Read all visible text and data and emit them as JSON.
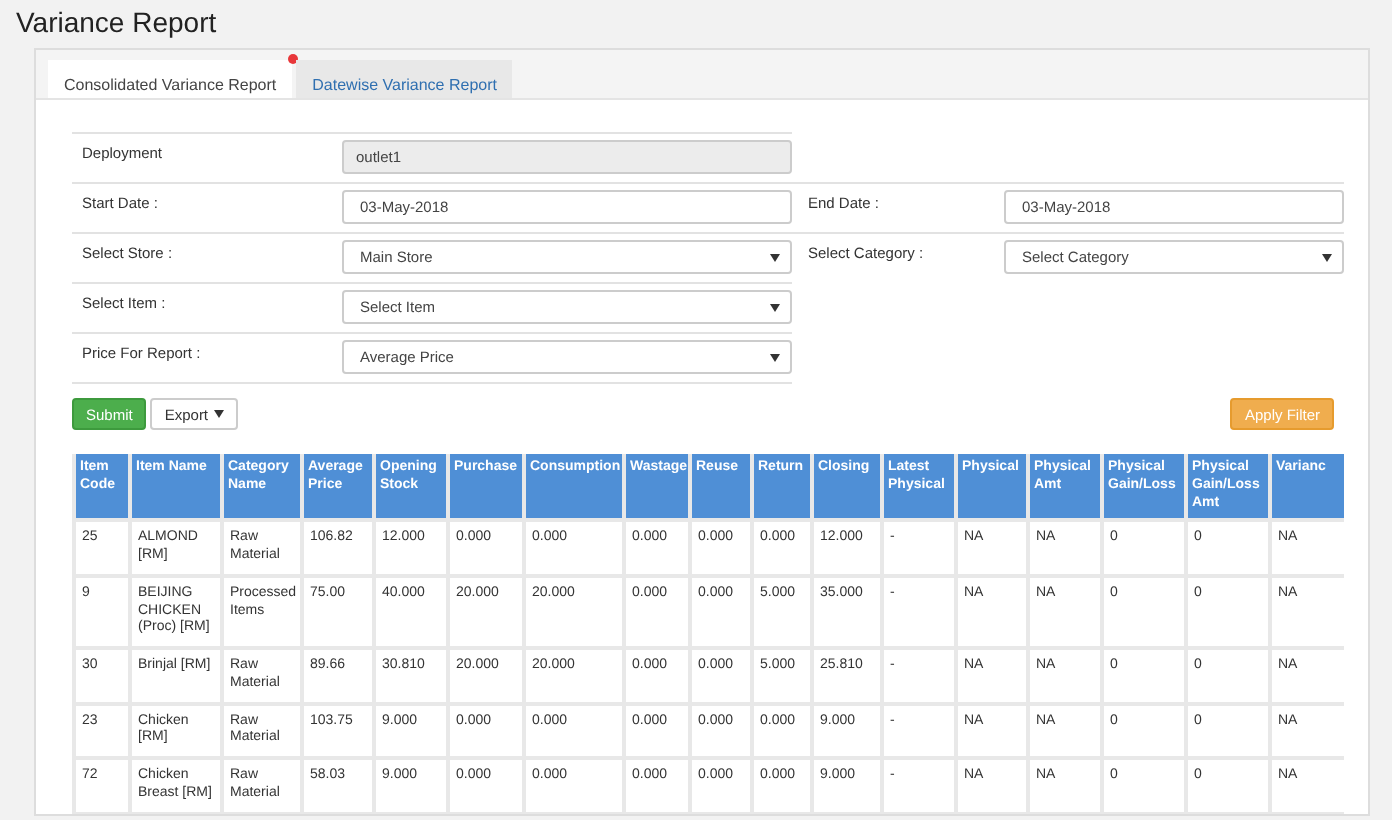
{
  "title": "Variance Report",
  "tabs": [
    {
      "label": "Consolidated Variance Report",
      "selected": true,
      "alert": true
    },
    {
      "label": "Datewise Variance Report",
      "selected": false,
      "alert": false
    }
  ],
  "form": {
    "rows": [
      [
        {
          "label": "Deployment",
          "kind": "readonly",
          "value": "outlet1"
        }
      ],
      [
        {
          "label": "Start Date :",
          "kind": "text",
          "value": "03-May-2018"
        },
        {
          "label": "End Date :",
          "kind": "text",
          "value": "03-May-2018"
        }
      ],
      [
        {
          "label": "Select Store :",
          "kind": "select",
          "value": "Main Store"
        },
        {
          "label": "Select Category :",
          "kind": "select",
          "value": "Select Category"
        }
      ],
      [
        {
          "label": "Select Item :",
          "kind": "select",
          "value": "Select Item"
        }
      ],
      [
        {
          "label": "Price For Report :",
          "kind": "select",
          "value": "Average Price"
        }
      ]
    ]
  },
  "buttons": [
    {
      "label": "Submit",
      "kind": "primary"
    },
    {
      "label": "Export",
      "kind": "dropdown"
    },
    {
      "label": "Apply Filter",
      "kind": "filter"
    }
  ],
  "table": {
    "columns": [
      "Item Code",
      "Item Name",
      "Category Name",
      "Average Price",
      "Opening Stock",
      "Purchase",
      "Consumption",
      "Wastage",
      "Reuse",
      "Return",
      "Closing",
      "Latest Physical",
      "Physical",
      "Physical Amt",
      "Physical Gain/Loss",
      "Physical Gain/Loss Amt",
      "Varianc"
    ],
    "rows": [
      [
        "25",
        "ALMOND [RM]",
        "Raw Material",
        "106.82",
        "12.000",
        "0.000",
        "0.000",
        "0.000",
        "0.000",
        "0.000",
        "12.000",
        "-",
        "NA",
        "NA",
        "0",
        "0",
        "NA"
      ],
      [
        "9",
        "BEIJING CHICKEN (Proc) [RM]",
        "Processed Items",
        "75.00",
        "40.000",
        "20.000",
        "20.000",
        "0.000",
        "0.000",
        "5.000",
        "35.000",
        "-",
        "NA",
        "NA",
        "0",
        "0",
        "NA"
      ],
      [
        "30",
        "Brinjal [RM]",
        "Raw Material",
        "89.66",
        "30.810",
        "20.000",
        "20.000",
        "0.000",
        "0.000",
        "5.000",
        "25.810",
        "-",
        "NA",
        "NA",
        "0",
        "0",
        "NA"
      ],
      [
        "23",
        "Chicken [RM]",
        "Raw Material",
        "103.75",
        "9.000",
        "0.000",
        "0.000",
        "0.000",
        "0.000",
        "0.000",
        "9.000",
        "-",
        "NA",
        "NA",
        "0",
        "0",
        "NA"
      ],
      [
        "72",
        "Chicken Breast [RM]",
        "Raw Material",
        "58.03",
        "9.000",
        "0.000",
        "0.000",
        "0.000",
        "0.000",
        "0.000",
        "9.000",
        "-",
        "NA",
        "NA",
        "0",
        "0",
        "NA"
      ]
    ]
  }
}
